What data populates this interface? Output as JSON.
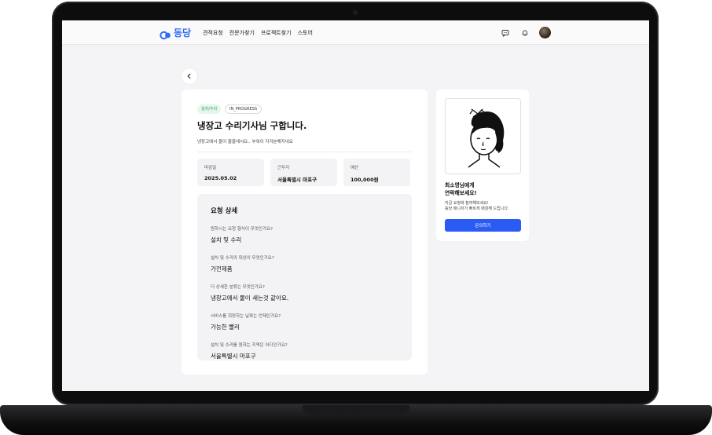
{
  "brand": {
    "name": "동당",
    "accent": "#2d6cf6"
  },
  "nav": {
    "links": [
      "견적요청",
      "전문가찾기",
      "프로젝트찾기",
      "스토어"
    ],
    "icons": [
      "chat-icon",
      "bell-icon"
    ]
  },
  "post": {
    "category_tag": "설치/수리",
    "status_tag": "IN_PROGRESS",
    "title": "냉장고 수리기사님 구합니다.",
    "description": "냉장고에서 물이 줄줄새서요.. 부엌이 지저분해지네요",
    "info": [
      {
        "label": "마감일",
        "value": "2025.05.02"
      },
      {
        "label": "근무지",
        "value": "서울특별시 마포구"
      },
      {
        "label": "예산",
        "value": "100,000원"
      }
    ]
  },
  "details": {
    "title": "요청 상세",
    "items": [
      {
        "question": "원하시는 요청 형식이 무엇인가요?",
        "answer": "설치 및 수리"
      },
      {
        "question": "설치 및 수리의 대상이 무엇인가요?",
        "answer": "가전제품"
      },
      {
        "question": "더 상세한 분류는 무엇인가요?",
        "answer": "냉장고에서 물이 새는것 같아요."
      },
      {
        "question": "서비스를 희망하는 날짜는 언제인가요?",
        "answer": "가능한 빨리"
      },
      {
        "question": "설치 및 수리를 원하는 지역은 어디인가요?",
        "answer": "서울특별시 마포구"
      }
    ]
  },
  "sidebar": {
    "headline_line1": "최소영님에게",
    "headline_line2": "연락해보세요!",
    "sub_line1": "지금 요청에 참여해보세요!",
    "sub_line2": "동당 매니저가 빠르게 매칭해 드립니다.",
    "contact_label": "문의하기",
    "button_color": "#2b5bf5"
  }
}
